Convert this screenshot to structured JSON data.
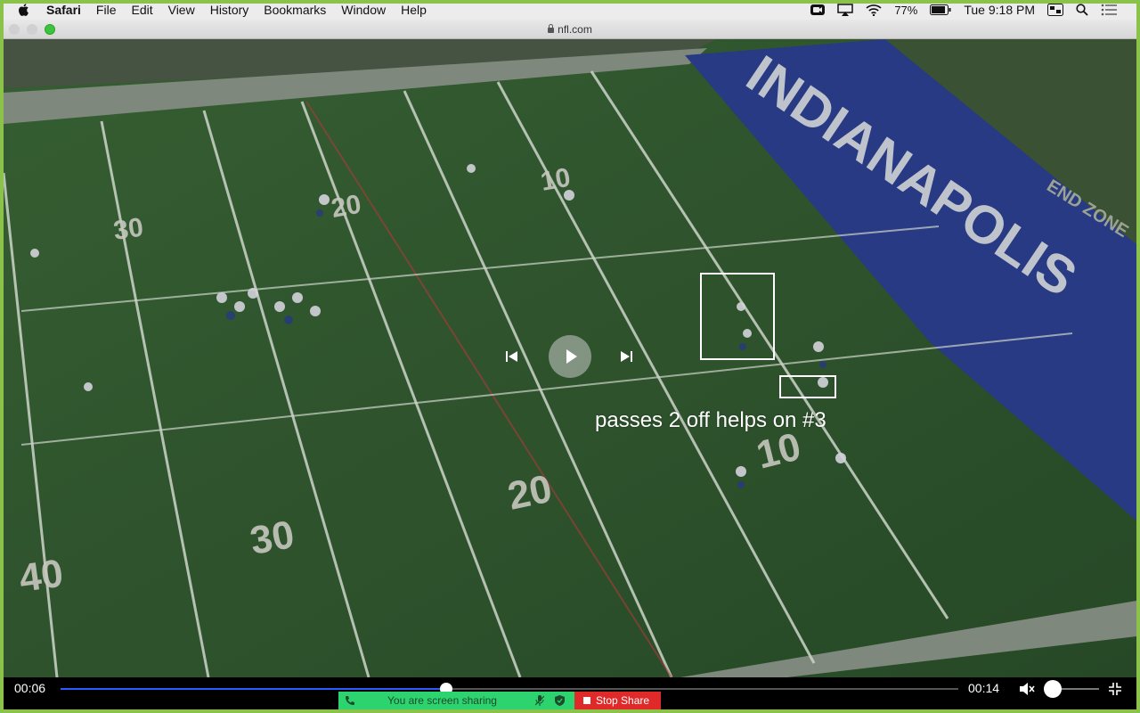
{
  "menubar": {
    "app_name": "Safari",
    "items": [
      "File",
      "Edit",
      "View",
      "History",
      "Bookmarks",
      "Window",
      "Help"
    ],
    "battery": "77%",
    "clock": "Tue 9:18 PM"
  },
  "browser": {
    "url": "nfl.com"
  },
  "video": {
    "caption": "passes 2 off helps on #3",
    "field_text": {
      "team": "INDIANAPOLIS",
      "endzone": "END ZONE",
      "yard_10_top": "10",
      "yard_20_top": "20",
      "yard_30_top": "30",
      "yard_10_bottom": "10",
      "yard_20_bottom": "20",
      "yard_30_bottom": "30",
      "yard_40_bottom": "40"
    }
  },
  "player": {
    "current_time": "00:06",
    "total_time": "00:14",
    "progress": 0.43,
    "volume": 0.0
  },
  "share_bar": {
    "sharing_label": "You are screen sharing",
    "stop_label": "Stop Share"
  },
  "colors": {
    "share_border": "#8bc34a",
    "field_green": "#2f5a2e",
    "endzone_blue": "#2b3f8f",
    "seek_fill": "#2a5bff",
    "sharing_green": "#2dd36f",
    "stop_red": "#e02a2a"
  }
}
